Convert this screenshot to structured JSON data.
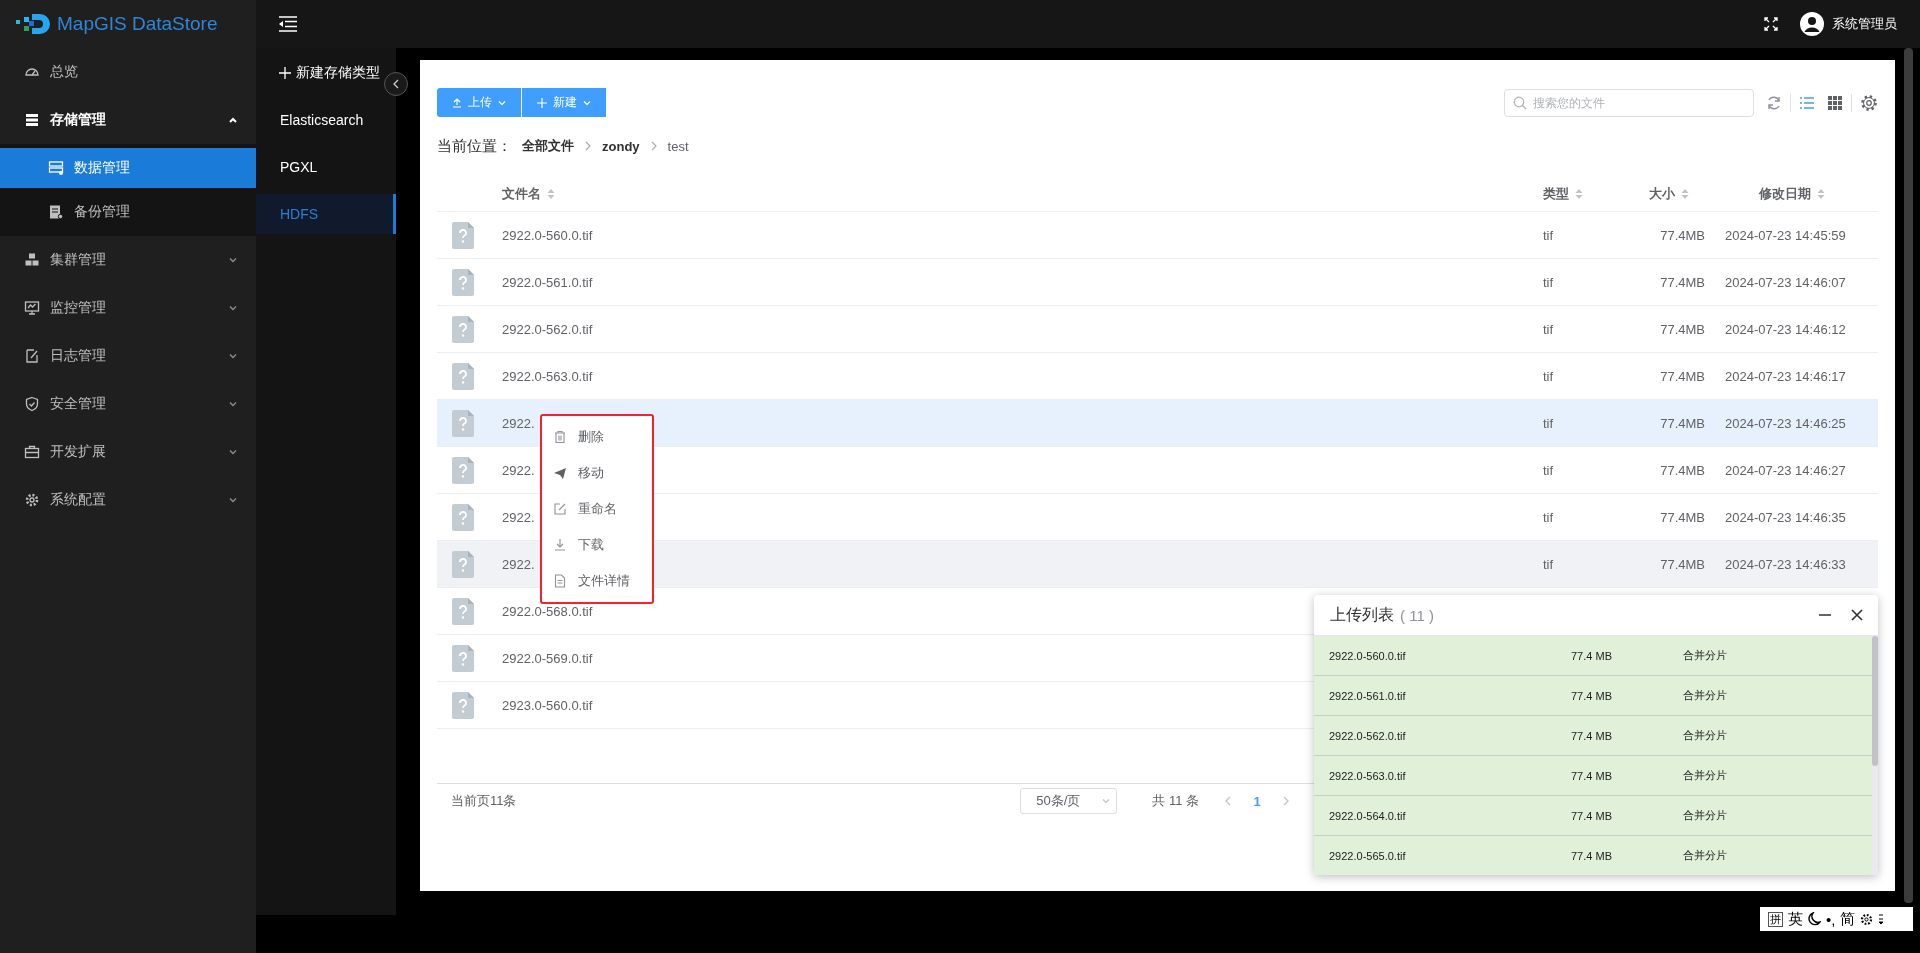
{
  "app": {
    "logo": "MapGIS DataStore"
  },
  "header": {
    "user": "系统管理员"
  },
  "sidebar": {
    "items": [
      {
        "label": "总览",
        "kind": "link",
        "selected": false
      },
      {
        "label": "存储管理",
        "kind": "group",
        "expanded": true,
        "selected": false,
        "children": [
          {
            "label": "数据管理",
            "selected": true
          },
          {
            "label": "备份管理",
            "selected": false
          }
        ]
      },
      {
        "label": "集群管理",
        "kind": "group",
        "expanded": false,
        "selected": false
      },
      {
        "label": "监控管理",
        "kind": "group",
        "expanded": false,
        "selected": false
      },
      {
        "label": "日志管理",
        "kind": "group",
        "expanded": false,
        "selected": false
      },
      {
        "label": "安全管理",
        "kind": "group",
        "expanded": false,
        "selected": false
      },
      {
        "label": "开发扩展",
        "kind": "group",
        "expanded": false,
        "selected": false
      },
      {
        "label": "系统配置",
        "kind": "group",
        "expanded": false,
        "selected": false
      }
    ]
  },
  "storage_types": {
    "new_button": "新建存储类型",
    "items": [
      {
        "label": "Elasticsearch",
        "selected": false
      },
      {
        "label": "PGXL",
        "selected": false
      },
      {
        "label": "HDFS",
        "selected": true
      }
    ]
  },
  "toolbar": {
    "buttons": [
      {
        "label": "上传"
      },
      {
        "label": "新建"
      }
    ],
    "search": {
      "placeholder": "搜索您的文件"
    },
    "view_modes": [
      {
        "kind": "list",
        "selected": true
      },
      {
        "kind": "grid",
        "selected": false
      }
    ]
  },
  "breadcrumb": {
    "label": "当前位置：",
    "items": [
      {
        "label": "全部文件",
        "current": false
      },
      {
        "label": "zondy",
        "current": false
      },
      {
        "label": "test",
        "current": true
      }
    ]
  },
  "table": {
    "columns": [
      "文件名",
      "类型",
      "大小",
      "修改日期"
    ],
    "rows": [
      {
        "name": "2922.0-560.0.tif",
        "type": "tif",
        "size": "77.4MB",
        "date": "2024-07-23 14:45:59",
        "selected": false,
        "hovered": false
      },
      {
        "name": "2922.0-561.0.tif",
        "type": "tif",
        "size": "77.4MB",
        "date": "2024-07-23 14:46:07",
        "selected": false,
        "hovered": false
      },
      {
        "name": "2922.0-562.0.tif",
        "type": "tif",
        "size": "77.4MB",
        "date": "2024-07-23 14:46:12",
        "selected": false,
        "hovered": false
      },
      {
        "name": "2922.0-563.0.tif",
        "type": "tif",
        "size": "77.4MB",
        "date": "2024-07-23 14:46:17",
        "selected": false,
        "hovered": false
      },
      {
        "name": "2922.",
        "type": "tif",
        "size": "77.4MB",
        "date": "2024-07-23 14:46:25",
        "selected": true,
        "hovered": false
      },
      {
        "name": "2922.",
        "type": "tif",
        "size": "77.4MB",
        "date": "2024-07-23 14:46:27",
        "selected": false,
        "hovered": false
      },
      {
        "name": "2922.",
        "type": "tif",
        "size": "77.4MB",
        "date": "2024-07-23 14:46:35",
        "selected": false,
        "hovered": false
      },
      {
        "name": "2922.",
        "type": "tif",
        "size": "77.4MB",
        "date": "2024-07-23 14:46:33",
        "selected": false,
        "hovered": true
      },
      {
        "name": "2922.0-568.0.tif",
        "selected": false,
        "hovered": false
      },
      {
        "name": "2922.0-569.0.tif",
        "selected": false,
        "hovered": false
      },
      {
        "name": "2923.0-560.0.tif",
        "selected": false,
        "hovered": false
      }
    ]
  },
  "context_menu": {
    "items": [
      {
        "label": "删除"
      },
      {
        "label": "移动"
      },
      {
        "label": "重命名"
      },
      {
        "label": "下载"
      },
      {
        "label": "文件详情"
      }
    ]
  },
  "pagination": {
    "summary": "当前页11条",
    "page_size": "50条/页",
    "total": "共 11 条",
    "pages": [
      {
        "label": "1",
        "selected": true
      }
    ]
  },
  "upload_list": {
    "title": "上传列表",
    "count": "( 11 )",
    "rows": [
      {
        "name": "2922.0-560.0.tif",
        "size": "77.4 MB",
        "status": "合并分片"
      },
      {
        "name": "2922.0-561.0.tif",
        "size": "77.4 MB",
        "status": "合并分片"
      },
      {
        "name": "2922.0-562.0.tif",
        "size": "77.4 MB",
        "status": "合并分片"
      },
      {
        "name": "2922.0-563.0.tif",
        "size": "77.4 MB",
        "status": "合并分片"
      },
      {
        "name": "2922.0-564.0.tif",
        "size": "77.4 MB",
        "status": "合并分片"
      },
      {
        "name": "2922.0-565.0.tif",
        "size": "77.4 MB",
        "status": "合并分片"
      }
    ]
  },
  "ime": {
    "mode": "拼",
    "language": "英",
    "punctuation": "•,",
    "script": "简"
  }
}
